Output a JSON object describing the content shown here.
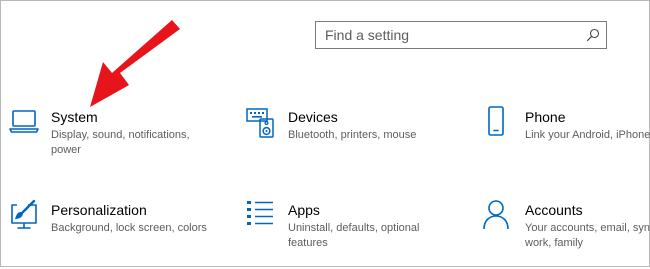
{
  "search": {
    "placeholder": "Find a setting",
    "icon": "search-icon"
  },
  "categories": [
    {
      "title": "System",
      "desc_line1": "Display, sound, notifications,",
      "desc_line2": "power",
      "icon": "laptop-icon"
    },
    {
      "title": "Devices",
      "desc_line1": "Bluetooth, printers, mouse",
      "desc_line2": "",
      "icon": "keyboard-speaker-icon"
    },
    {
      "title": "Phone",
      "desc_line1": "Link your Android, iPhone",
      "desc_line2": "",
      "icon": "phone-icon"
    },
    {
      "title": "Personalization",
      "desc_line1": "Background, lock screen, colors",
      "desc_line2": "",
      "icon": "paint-brush-screen-icon"
    },
    {
      "title": "Apps",
      "desc_line1": "Uninstall, defaults, optional",
      "desc_line2": "features",
      "icon": "apps-list-icon"
    },
    {
      "title": "Accounts",
      "desc_line1": "Your accounts, email, sync,",
      "desc_line2": "work, family",
      "icon": "person-icon"
    }
  ],
  "colors": {
    "accent": "#0067c0",
    "annotation_arrow": "#e8141b",
    "description_text": "#5d5d5d"
  }
}
